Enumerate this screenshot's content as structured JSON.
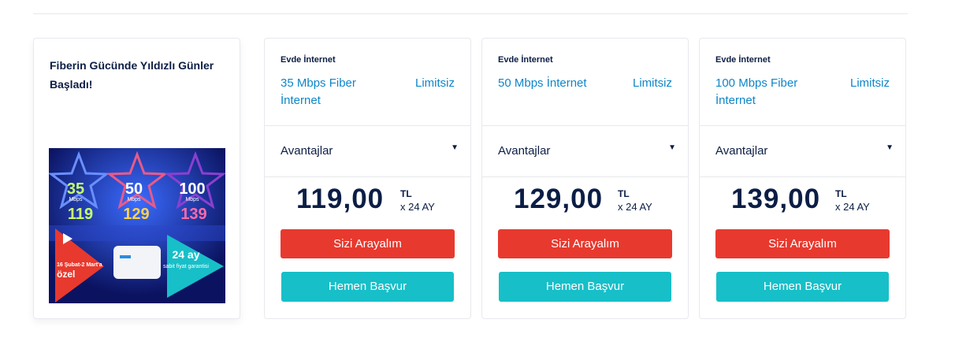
{
  "promo": {
    "title": "Fiberin Gücünde Yıldızlı Günler Başladı!",
    "banner": {
      "stars": [
        {
          "speed": "35",
          "unit": "Mbps",
          "price": "119",
          "color": "#6a8fff"
        },
        {
          "speed": "50",
          "unit": "Mbps",
          "price": "129",
          "color": "#e85a8a"
        },
        {
          "speed": "100",
          "unit": "Mbps",
          "price": "139",
          "color": "#8a3fd1"
        }
      ],
      "campaign_text": "16 Şubat-2 Mart'a özel",
      "term_big": "24 ay",
      "term_small": "sabit fiyat garantisi"
    }
  },
  "plans": [
    {
      "type": "Evde İnternet",
      "name": "35 Mbps Fiber İnternet",
      "quota": "Limitsiz",
      "advantages_label": "Avantajlar",
      "price": "119,00",
      "currency": "TL",
      "term": "x 24 AY",
      "call_label": "Sizi Arayalım",
      "apply_label": "Hemen Başvur"
    },
    {
      "type": "Evde İnternet",
      "name": "50 Mbps İnternet",
      "quota": "Limitsiz",
      "advantages_label": "Avantajlar",
      "price": "129,00",
      "currency": "TL",
      "term": "x 24 AY",
      "call_label": "Sizi Arayalım",
      "apply_label": "Hemen Başvur"
    },
    {
      "type": "Evde İnternet",
      "name": "100 Mbps Fiber İnternet",
      "quota": "Limitsiz",
      "advantages_label": "Avantajlar",
      "price": "139,00",
      "currency": "TL",
      "term": "x 24 AY",
      "call_label": "Sizi Arayalım",
      "apply_label": "Hemen Başvur"
    }
  ],
  "colors": {
    "accent_red": "#e8392e",
    "accent_teal": "#17bfc8",
    "link_blue": "#0d86c9",
    "navy": "#0b1e45"
  }
}
